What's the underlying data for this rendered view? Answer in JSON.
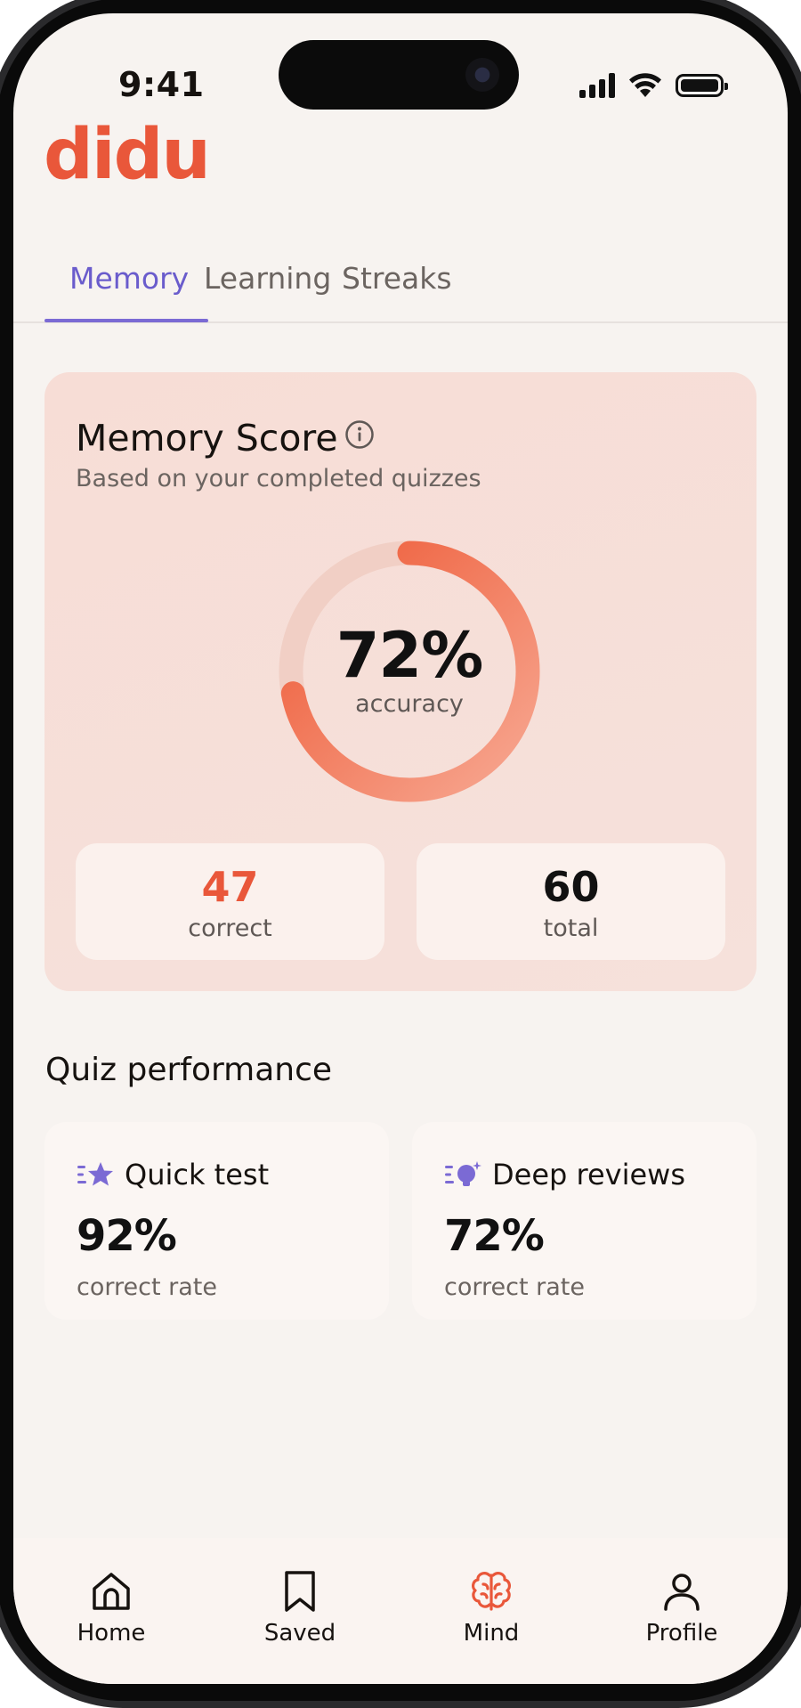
{
  "status_bar": {
    "time": "9:41"
  },
  "app": {
    "logo": "didu",
    "accent": "#e9573a",
    "brand_purple": "#6a5ccc"
  },
  "tabs": [
    {
      "label": "Memory",
      "active": true
    },
    {
      "label": "Learning",
      "active": false
    },
    {
      "label": "Streaks",
      "active": false
    }
  ],
  "memory_card": {
    "title": "Memory Score",
    "subtitle": "Based on your completed quizzes",
    "accuracy_value": "72%",
    "accuracy_label": "accuracy",
    "accuracy_fraction": 0.72,
    "correct": {
      "value": "47",
      "label": "correct"
    },
    "total": {
      "value": "60",
      "label": "total"
    }
  },
  "quiz_performance": {
    "title": "Quiz performance",
    "cards": [
      {
        "name": "Quick test",
        "icon": "star-icon",
        "value": "92%",
        "label": "correct rate"
      },
      {
        "name": "Deep reviews",
        "icon": "lightbulb-icon",
        "value": "72%",
        "label": "correct rate"
      }
    ]
  },
  "bottom_nav": [
    {
      "label": "Home",
      "icon": "home-icon",
      "active": false
    },
    {
      "label": "Saved",
      "icon": "bookmark-icon",
      "active": false
    },
    {
      "label": "Mind",
      "icon": "brain-icon",
      "active": true
    },
    {
      "label": "Profile",
      "icon": "profile-icon",
      "active": false
    }
  ]
}
